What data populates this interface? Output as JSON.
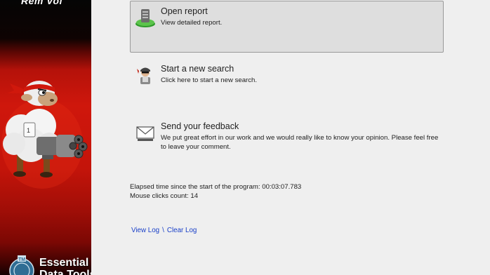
{
  "banner": {
    "logo_text": "Rem  Vol",
    "brand_text": "Essential\nData Tools"
  },
  "actions": [
    {
      "id": "open-report",
      "icon": "database-report-icon",
      "title": "Open report",
      "description": "View detailed report.",
      "selected": true
    },
    {
      "id": "new-search",
      "icon": "agent-search-icon",
      "title": "Start a new search",
      "description": "Click here to start a new search.",
      "selected": false
    },
    {
      "id": "feedback",
      "icon": "envelope-icon",
      "title": "Send your feedback",
      "description": "We put great effort in our work and we would really like to know your opinion. Please feel free to leave your comment.",
      "selected": false
    }
  ],
  "stats": {
    "elapsed_label": "Elapsed time since the start of the program:",
    "elapsed_value": "00:03:07.783",
    "clicks_label": "Mouse clicks count:",
    "clicks_value": "14"
  },
  "links": {
    "view_log": "View Log",
    "separator": "\\",
    "clear_log": "Clear Log"
  },
  "colors": {
    "banner_red": "#c4140a",
    "link_blue": "#1a40c8",
    "selected_bg": "#dedede"
  }
}
